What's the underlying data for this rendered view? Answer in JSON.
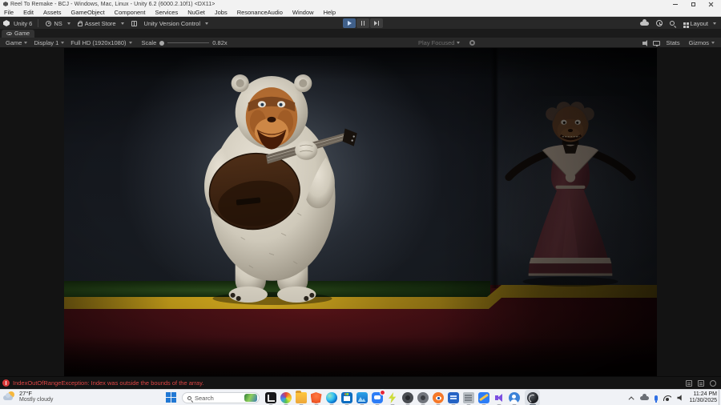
{
  "window": {
    "title": "Reel To Remake - BCJ - Windows, Mac, Linux - Unity 6.2 (6000.2.10f1) <DX11>"
  },
  "menu_bar": {
    "items": [
      "File",
      "Edit",
      "Assets",
      "GameObject",
      "Component",
      "Services",
      "NuGet",
      "Jobs",
      "ResonanceAudio",
      "Window",
      "Help"
    ]
  },
  "toolbar": {
    "unity_version_badge": "Unity 6",
    "account_label": "NS",
    "asset_store_label": "Asset Store",
    "version_control_label": "Unity Version Control",
    "layout_label": "Layout"
  },
  "game_view": {
    "tab_label": "Game",
    "mode_dropdown": "Game",
    "display_dropdown": "Display 1",
    "resolution_dropdown": "Full HD (1920x1080)",
    "scale_label": "Scale",
    "scale_value": "0.82x",
    "play_focused_label": "Play Focused",
    "stats_label": "Stats",
    "gizmos_label": "Gizmos"
  },
  "status_bar": {
    "error_message": "IndexOutOfRangeException: Index was outside the bounds of the array."
  },
  "taskbar": {
    "weather": {
      "temperature": "27°F",
      "condition": "Mostly cloudy"
    },
    "search": {
      "placeholder": "Search"
    },
    "clock": {
      "time": "11:24 PM",
      "date": "11/30/2025"
    }
  },
  "scene": {
    "stage_colors": {
      "stripe": "#c9a11a",
      "floor": "#471015",
      "platform": "#1a3210",
      "wall_glow": "#7a8694"
    },
    "characters": [
      "white bear animatronic playing acoustic guitar under spotlight",
      "possum lady animatronic in rose dress with bonnet, dimly lit"
    ]
  }
}
